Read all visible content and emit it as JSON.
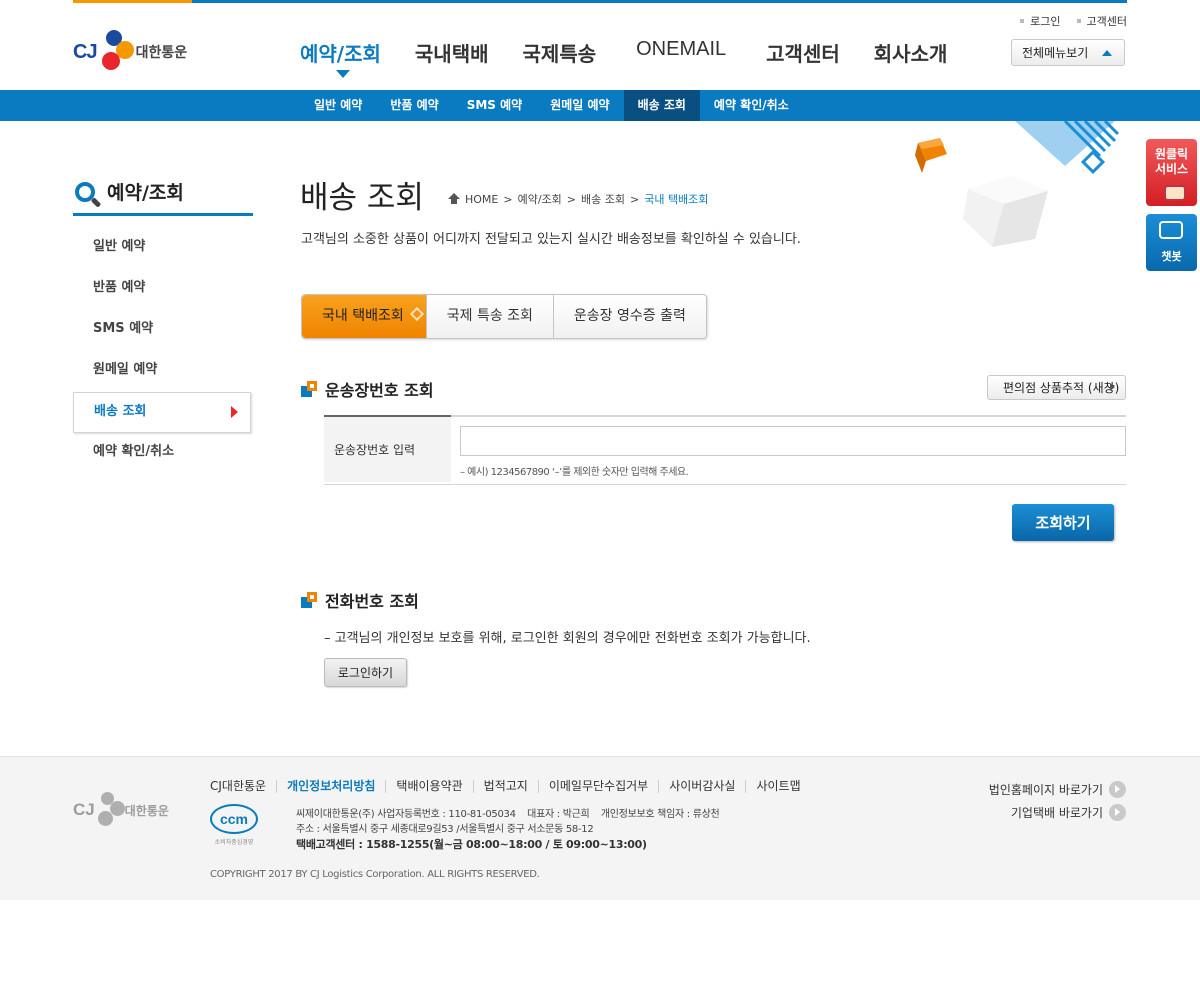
{
  "header": {
    "util_links": [
      "로그인",
      "고객센터"
    ],
    "logo_text": "대한통운",
    "logo_cj": "CJ",
    "gnb": [
      "예약/조회",
      "국내택배",
      "국제특송",
      "ONEMAIL",
      "고객센터",
      "회사소개"
    ],
    "all_menu_label": "전체메뉴보기"
  },
  "subnav": [
    "일반 예약",
    "반품 예약",
    "SMS 예약",
    "원메일 예약",
    "배송 조회",
    "예약 확인/취소"
  ],
  "sidebar": {
    "title": "예약/조회",
    "items": [
      "일반 예약",
      "반품 예약",
      "SMS 예약",
      "원메일 예약",
      "배송 조회",
      "예약 확인/취소"
    ]
  },
  "page": {
    "title": "배송 조회",
    "breadcrumb": [
      "HOME",
      "예약/조회",
      "배송 조회",
      "국내 택배조회"
    ],
    "description": "고객님의 소중한 상품이 어디까지 전달되고 있는지 실시간 배송정보를 확인하실 수 있습니다."
  },
  "tabs": [
    "국내 택배조회",
    "국제 특송 조회",
    "운송장 영수증 출력"
  ],
  "waybill": {
    "heading": "운송장번호 조회",
    "store_track_label": "편의점 상품추적 (새창)",
    "field_label": "운송장번호 입력",
    "input_value": "",
    "hint": "– 예시) 1234567890 ‘–’를 제외한 숫자만 입력해 주세요.",
    "search_label": "조회하기"
  },
  "phone": {
    "heading": "전화번호 조회",
    "note": "– 고객님의 개인정보 보호를 위해, 로그인한 회원의 경우에만 전화번호 조회가 가능합니다.",
    "login_label": "로그인하기"
  },
  "floating": {
    "oneclick": [
      "원클릭",
      "서비스"
    ],
    "chatbot": "챗봇"
  },
  "footer": {
    "logo_text": "대한통운",
    "logo_cj": "CJ",
    "links": [
      "CJ대한통운",
      "개인정보처리방침",
      "택배이용약관",
      "법적고지",
      "이메일무단수집거부",
      "사이버감사실",
      "사이트맵"
    ],
    "ccm_label": "ccm",
    "ccm_sub": "소비자중심경영",
    "info_line1": "씨제이대한통운(주) 사업자등록번호 : 110-81-05034    대표자 : 박근희    개인정보보호 책임자 : 류상천",
    "info_line2": "주소 : 서울특별시 중구 세종대로9길53 /서울특별시 중구 서소문동 58-12",
    "info_line3": "택배고객센터 : 1588-1255(월~금 08:00~18:00 / 토 09:00~13:00)",
    "copyright": "COPYRIGHT 2017 BY CJ Logistics Corporation. ALL RIGHTS RESERVED.",
    "right_links": [
      "법인홈페이지 바로가기",
      "기업택배 바로가기"
    ]
  },
  "colors": {
    "primary": "#0b7bc1",
    "accent": "#f39800",
    "subnav_active": "#0a4f82",
    "red": "#e8262e"
  }
}
